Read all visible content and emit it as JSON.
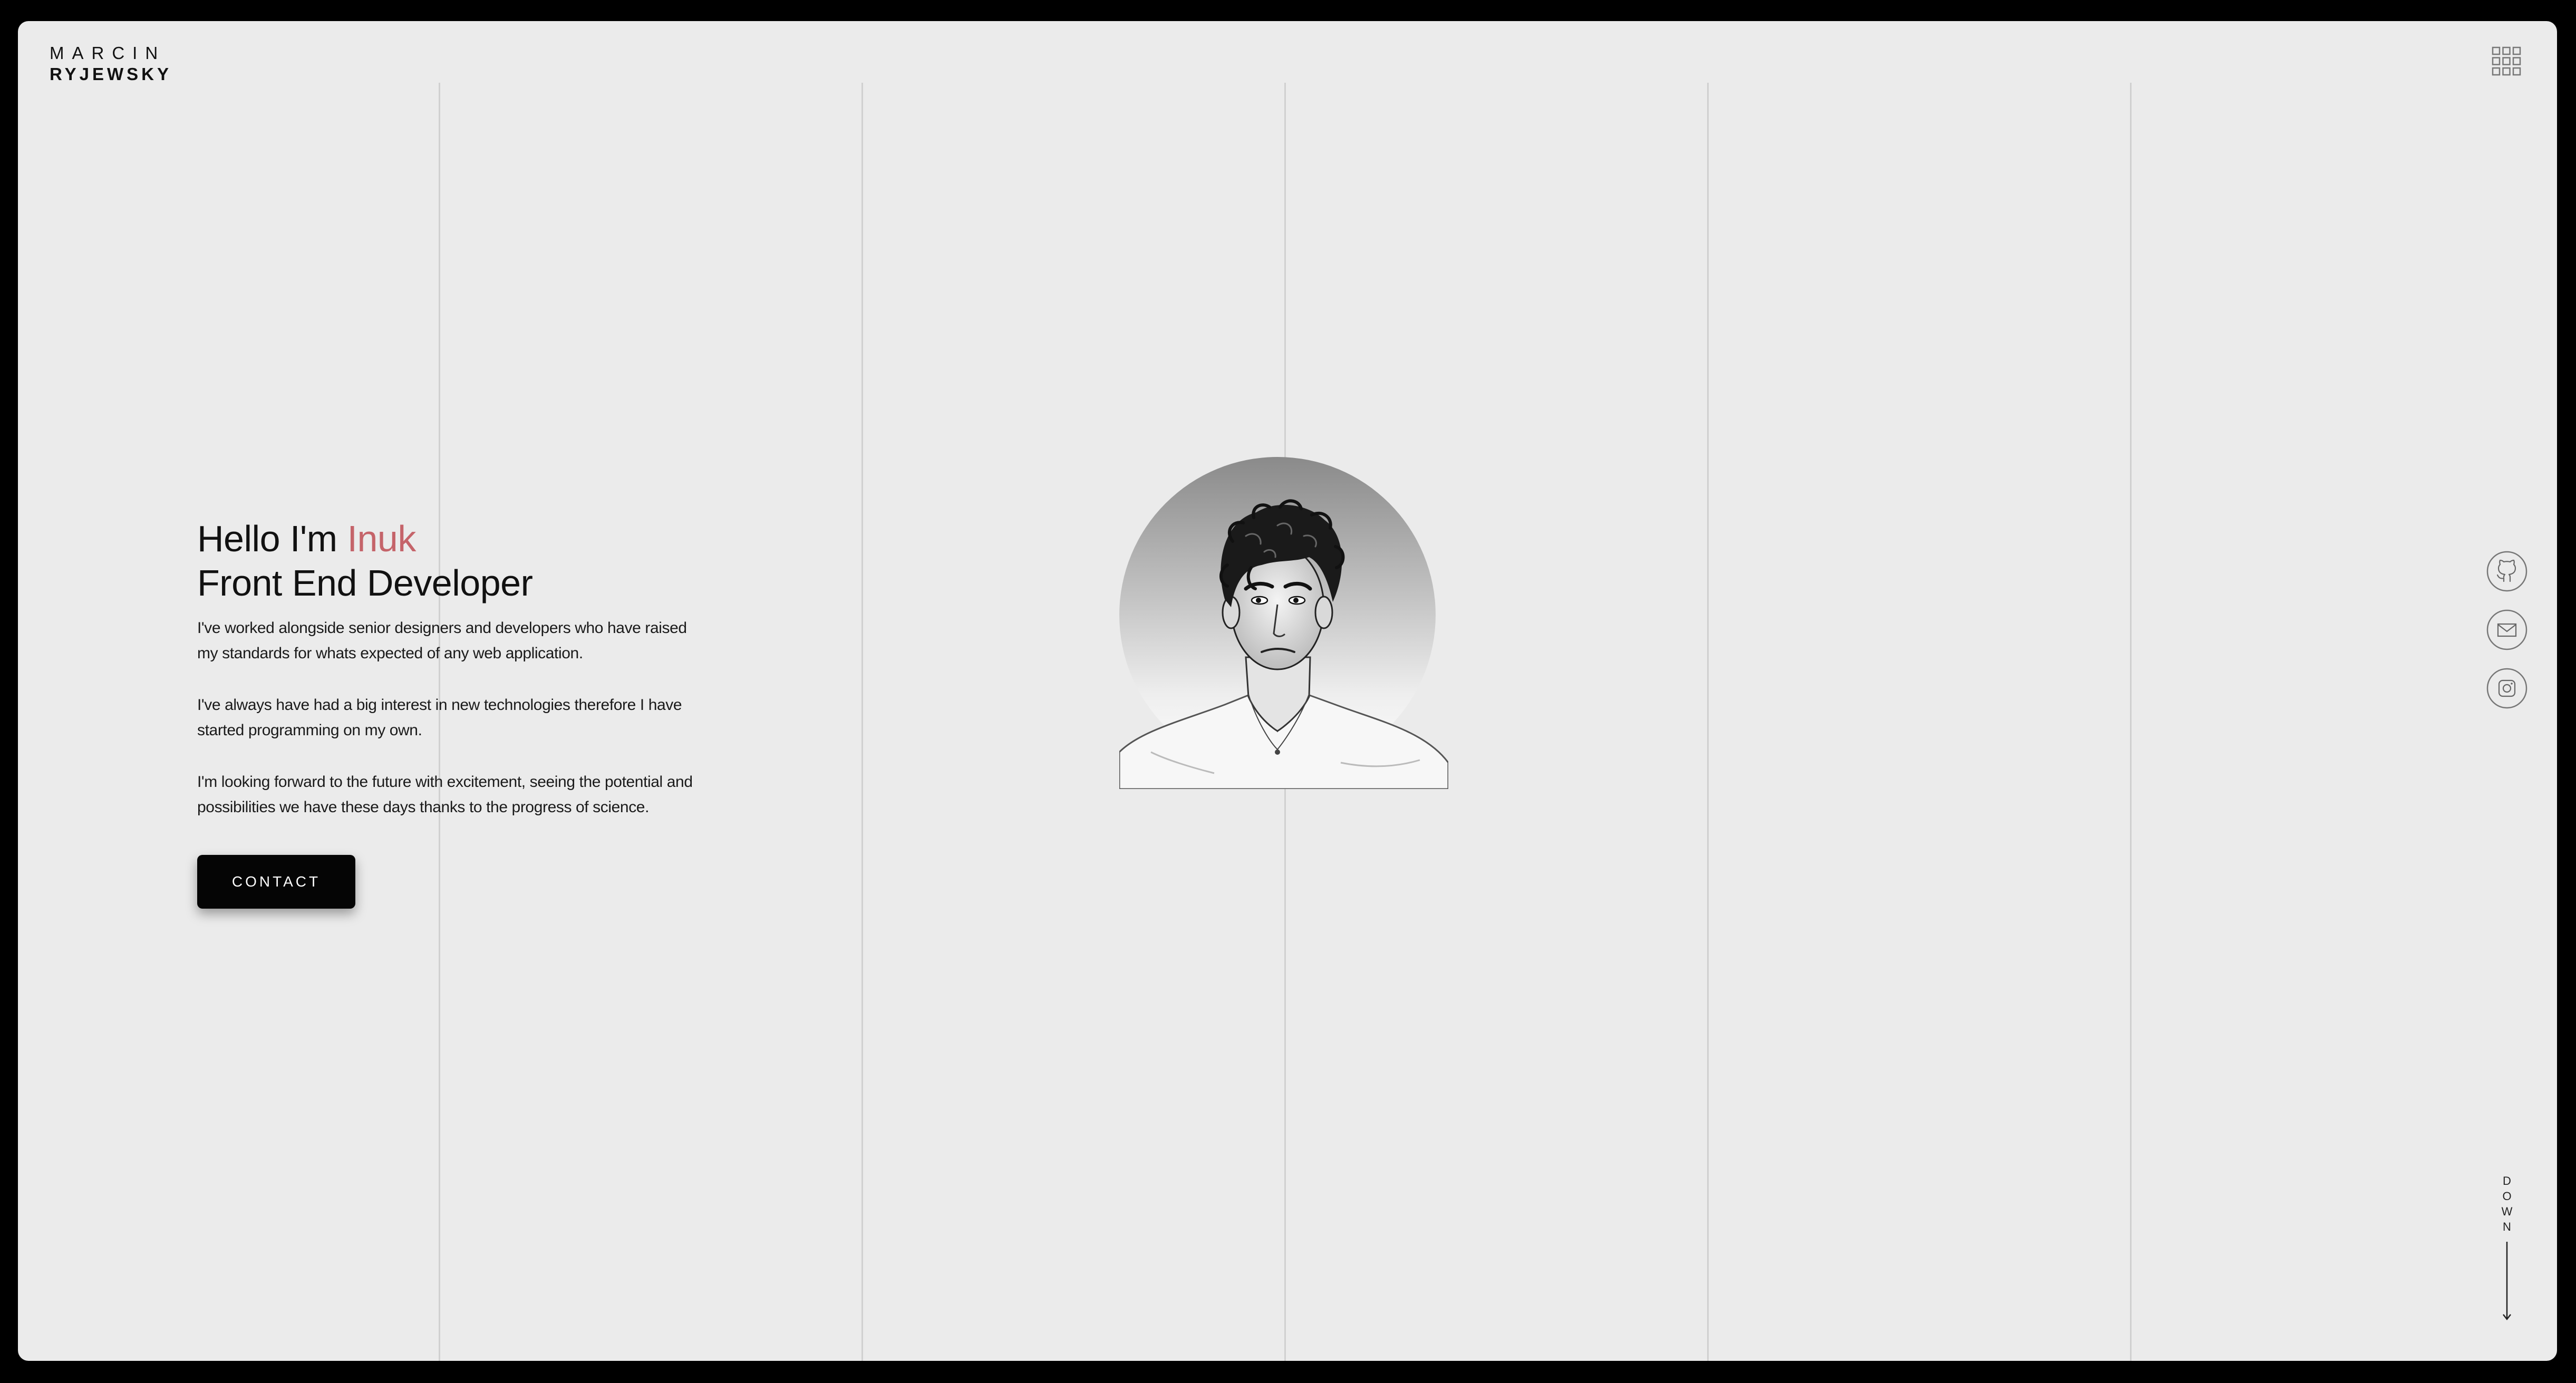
{
  "logo": {
    "first_name": "MARCIN",
    "last_name": "RYJEWSKY"
  },
  "header": {
    "menu_icon": "grid-menu-icon"
  },
  "hero": {
    "greeting": "Hello I'm ",
    "name": "Inuk",
    "role": "Front End Developer",
    "paragraphs": [
      "I've worked alongside senior designers and developers who have raised my standards for whats expected of any web application.",
      "I've always have had a big interest in new technologies therefore I have started programming on my own.",
      "I'm looking forward to the future with excitement, seeing the potential and possibilities we have these days thanks to the progress of science."
    ],
    "contact_label": "CONTACT"
  },
  "social": {
    "icons": [
      "github-icon",
      "mail-icon",
      "instagram-icon"
    ]
  },
  "scroll": {
    "letters": [
      "D",
      "O",
      "W",
      "N"
    ],
    "icon": "arrow-down-icon"
  },
  "colors": {
    "background": "#ebebeb",
    "accent": "#c5646a",
    "text": "#111111",
    "button": "#050505",
    "grid_lines": "#d0d0d0"
  }
}
